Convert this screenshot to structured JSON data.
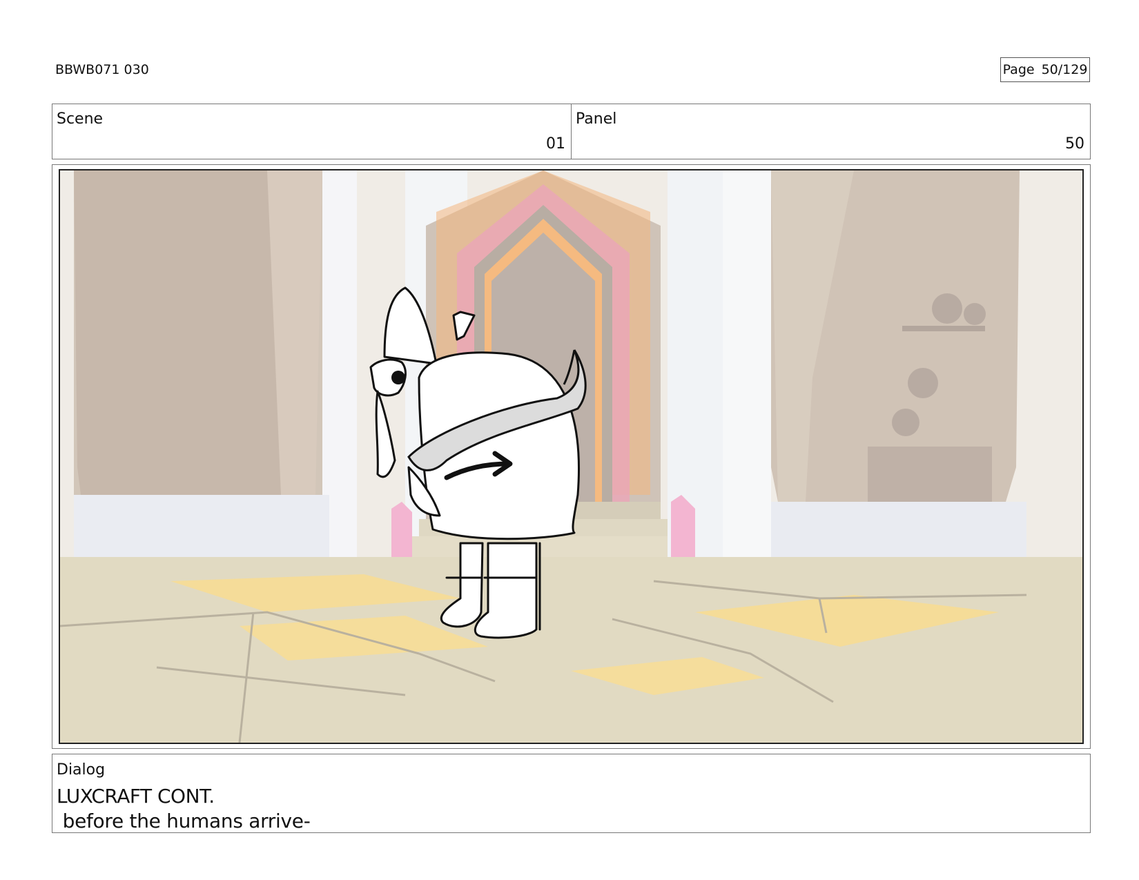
{
  "header": {
    "production_id": "BBWB071 030",
    "page_label": "Page",
    "page_value": "50/129"
  },
  "info": {
    "scene_label": "Scene",
    "scene_value": "01",
    "panel_label": "Panel",
    "panel_value": "50"
  },
  "dialog": {
    "label": "Dialog",
    "speaker": "LUXCRAFT CONT.",
    "line": " before the humans arrive-"
  },
  "colors": {
    "wall": "#c9b9a8",
    "pillar": "#eef0f3",
    "arch_orange": "#f2a860",
    "arch_pink": "#e59aae",
    "floor": "#d8cfae",
    "floor_light": "#f3d27a",
    "crystal": "#ef9fc2"
  }
}
